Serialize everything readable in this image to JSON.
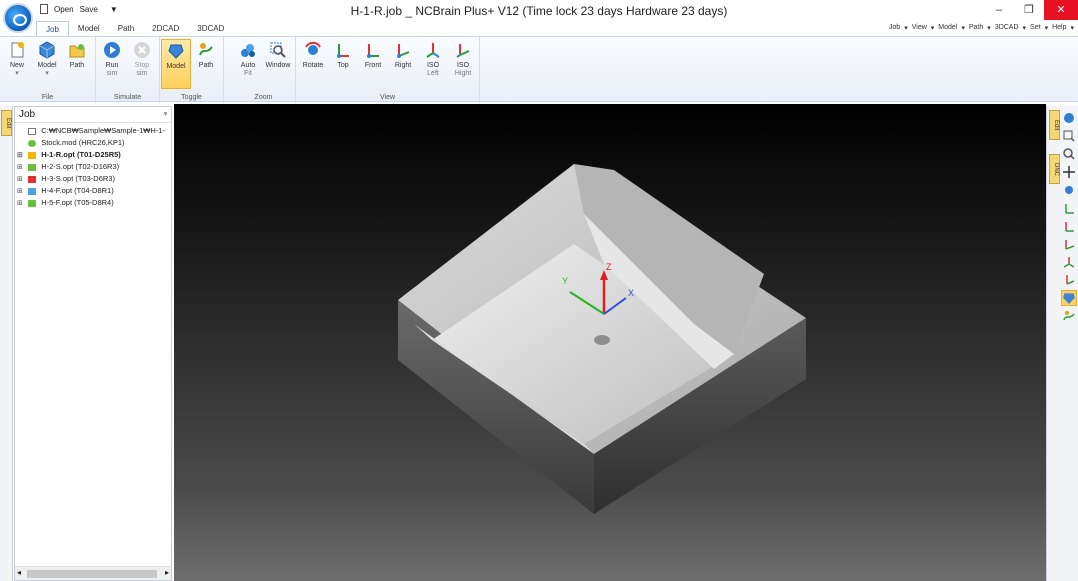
{
  "window": {
    "title": "H-1-R.job _  NCBrain Plus+ V12  (Time lock 23 days Hardware 23 days)",
    "minimize": "–",
    "maximize": "❐",
    "close": "✕"
  },
  "quick_access": {
    "open": "Open",
    "save": "Save",
    "more": "▼"
  },
  "tabs": [
    {
      "label": "Job",
      "active": true
    },
    {
      "label": "Model"
    },
    {
      "label": "Path"
    },
    {
      "label": "2DCAD"
    },
    {
      "label": "3DCAD"
    }
  ],
  "right_menu": [
    "Job",
    "View",
    "Model",
    "Path",
    "3DCAD",
    "Set",
    "Help"
  ],
  "ribbon": {
    "file": {
      "label": "File",
      "new": "New",
      "model": "Model",
      "path": "Path"
    },
    "simulate": {
      "label": "Simulate",
      "run": "Run",
      "run_sub": "sim",
      "stop": "Stop",
      "stop_sub": "sim"
    },
    "toggle": {
      "label": "Toggle",
      "model": "Model",
      "path": "Path"
    },
    "zoom": {
      "label": "Zoom",
      "auto": "Auto",
      "auto_sub": "Fit",
      "window": "Window"
    },
    "view": {
      "label": "View",
      "rotate": "Rotate",
      "top": "Top",
      "front": "Front",
      "right": "Right",
      "iso_left": "ISO",
      "iso_left_sub": "Left",
      "iso_right": "ISO",
      "iso_right_sub": "Hight"
    }
  },
  "job_panel": {
    "title": "Job",
    "pin": "ᵩ",
    "items": [
      {
        "text": "C:₩NCB₩Sample₩Sample-1₩H-1-"
      },
      {
        "text": "Stock.mod (HRC26,KP1)"
      },
      {
        "text": "H-1-R.opt (T01-D25R5)"
      },
      {
        "text": "H-2-S.opt (T02-D16R3)"
      },
      {
        "text": "H-3-S.opt (T03-D6R3)"
      },
      {
        "text": "H-4-F.opt (T04-D8R1)"
      },
      {
        "text": "H-5-F.opt (T05-D8R4)"
      }
    ]
  },
  "side_tabs": {
    "left": "Edit",
    "right_1": "Edit",
    "right_2": "DNC"
  },
  "axis": {
    "x": "X",
    "y": "Y",
    "z": "Z"
  },
  "colors": {
    "accent": "#1a4d8f",
    "active_button": "#ffd15c",
    "close": "#e81123"
  }
}
